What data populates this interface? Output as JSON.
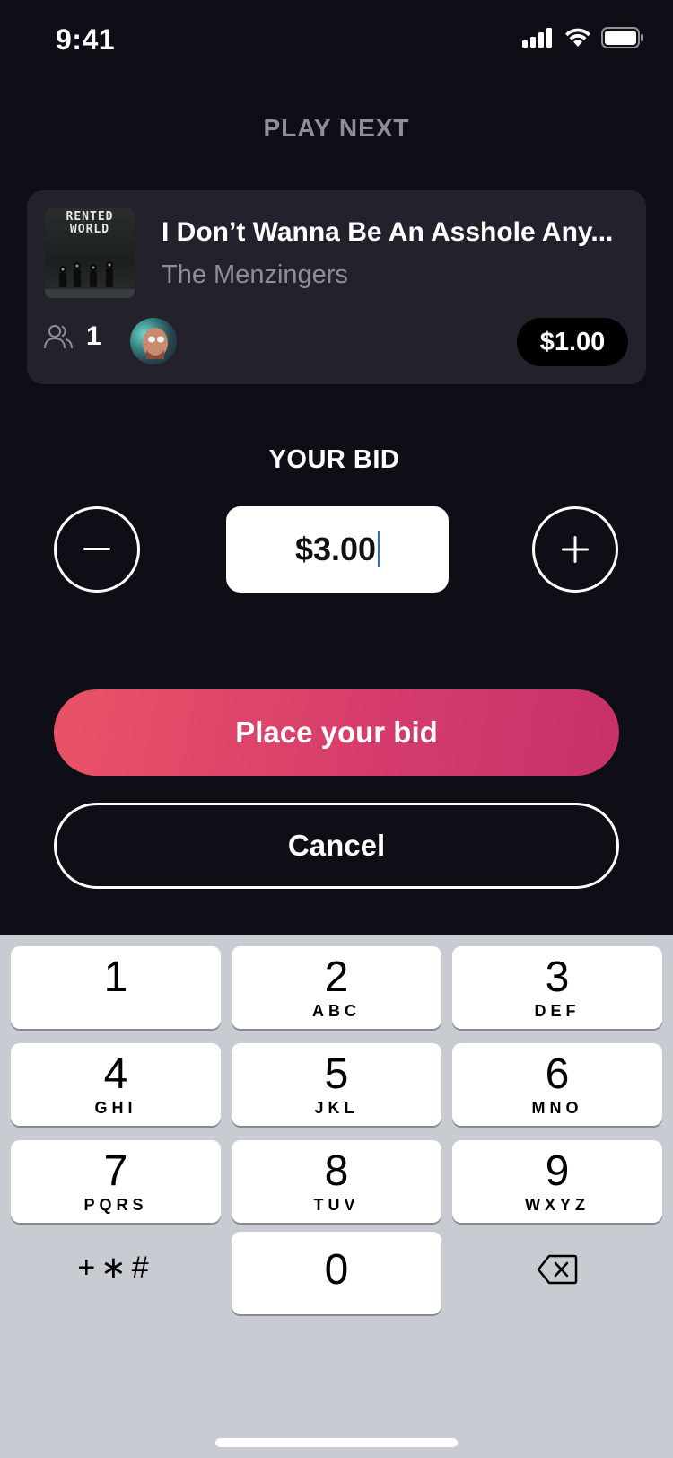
{
  "status_bar": {
    "time": "9:41"
  },
  "header": {
    "title": "PLAY NEXT"
  },
  "song": {
    "album_text": "RENTED WORLD",
    "title": "I Don’t Wanna Be An Asshole Any...",
    "artist": "The Menzingers",
    "bidder_count": "1",
    "current_bid": "$1.00"
  },
  "bid": {
    "label": "YOUR BID",
    "value": "$3.00"
  },
  "actions": {
    "place_bid": "Place your bid",
    "cancel": "Cancel"
  },
  "keypad": {
    "keys": [
      {
        "num": "1",
        "letters": ""
      },
      {
        "num": "2",
        "letters": "ABC"
      },
      {
        "num": "3",
        "letters": "DEF"
      },
      {
        "num": "4",
        "letters": "GHI"
      },
      {
        "num": "5",
        "letters": "JKL"
      },
      {
        "num": "6",
        "letters": "MNO"
      },
      {
        "num": "7",
        "letters": "PQRS"
      },
      {
        "num": "8",
        "letters": "TUV"
      },
      {
        "num": "9",
        "letters": "WXYZ"
      },
      {
        "num": "0",
        "letters": ""
      }
    ],
    "symbols": "+∗#"
  },
  "colors": {
    "background": "#0e0e16",
    "card": "#23222c",
    "accent_start": "#ea5366",
    "accent_end": "#c8306b",
    "muted_text": "#8e8e96",
    "keypad_bg": "#c8cbd2"
  },
  "icons": [
    "signal-icon",
    "wifi-icon",
    "battery-icon",
    "people-icon",
    "minus-icon",
    "plus-icon",
    "backspace-icon"
  ]
}
